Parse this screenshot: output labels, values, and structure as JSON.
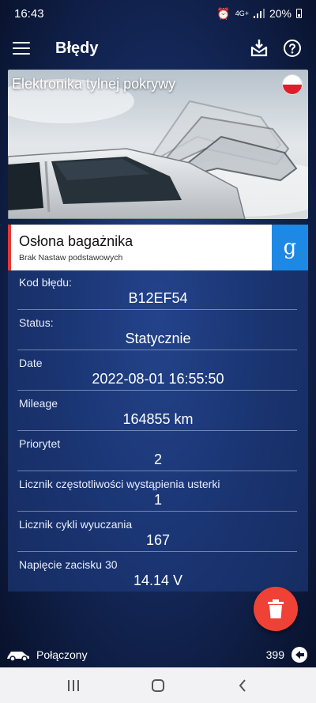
{
  "status_bar": {
    "time": "16:43",
    "network": "4G+",
    "battery": "20%"
  },
  "app_bar": {
    "title": "Błędy"
  },
  "hero": {
    "title": "Elektronika tylnej pokrywy"
  },
  "fault": {
    "name": "Osłona bagażnika",
    "subtitle": "Brak Nastaw podstawowych",
    "google_label": "g",
    "rows": [
      {
        "label": "Kod błędu:",
        "value": "B12EF54"
      },
      {
        "label": "Status:",
        "value": "Statycznie"
      },
      {
        "label": "Date",
        "value": "2022-08-01 16:55:50"
      },
      {
        "label": "Mileage",
        "value": "164855 km"
      },
      {
        "label": "Priorytet",
        "value": "2"
      },
      {
        "label": "Licznik częstotliwości wystąpienia usterki",
        "value": "1"
      },
      {
        "label": "Licznik cykli wyuczania",
        "value": "167"
      },
      {
        "label": "Napięcie zacisku 30",
        "value": "14.14 V"
      }
    ]
  },
  "connection": {
    "label": "Połączony",
    "count": "399"
  },
  "colors": {
    "accent_red": "#ef4136",
    "google_blue": "#1e88e5",
    "background": "#14285a"
  }
}
